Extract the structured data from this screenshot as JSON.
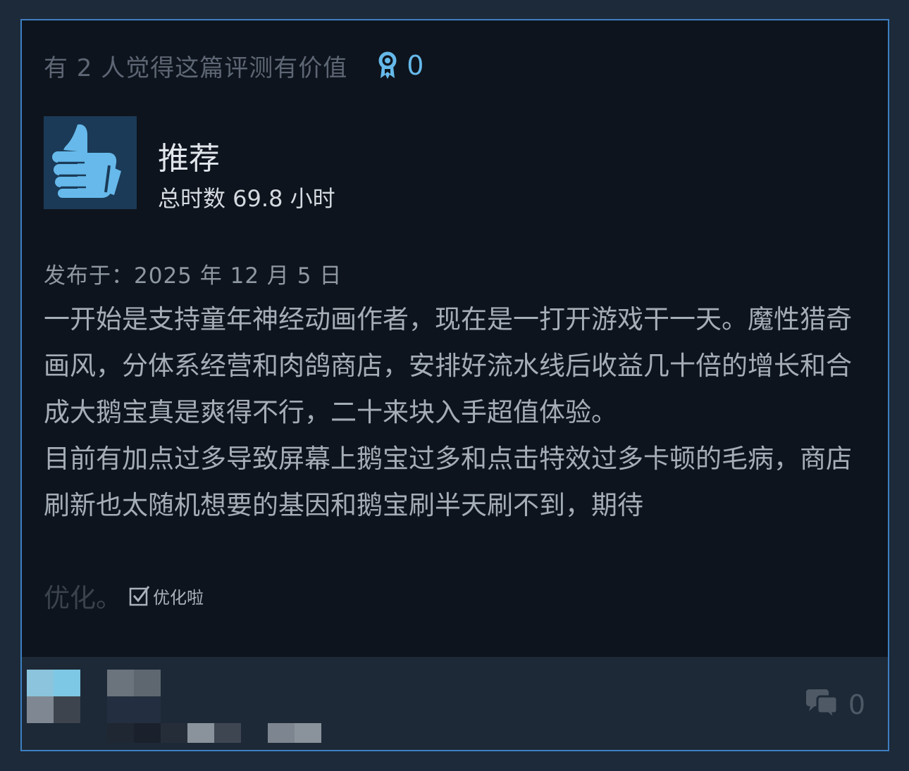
{
  "helpful": {
    "text": "有 2 人觉得这篇评测有价值",
    "award_icon": "award-ribbon-icon",
    "award_count": "0"
  },
  "rating": {
    "icon": "thumbs-up-icon",
    "verdict": "推荐",
    "hours": "总时数 69.8 小时"
  },
  "review": {
    "posted": "发布于：2025 年 12 月 5 日",
    "paragraphs": [
      "一开始是支持童年神经动画作者，现在是一打开游戏干一天。魔性猎奇画风，分体系经营和肉鸽商店，安排好流水线后收益几十倍的增长和合成大鹅宝真是爽得不行，二十来块入手超值体验。",
      "目前有加点过多导致屏幕上鹅宝过多和点击特效过多卡顿的毛病，商店刷新也太随机想要的基因和鹅宝刷半天刷不到，期待"
    ],
    "faded_tail": "优化。",
    "checkbox_label": "优化啦"
  },
  "footer": {
    "comment_icon": "comment-bubbles-icon",
    "comment_count": "0"
  },
  "colors": {
    "page_bg": "#1d2a3a",
    "card_bg": "#0e141d",
    "card_border": "#3d7fc1",
    "accent": "#66b9ea",
    "footer_bg": "#1d2937"
  }
}
